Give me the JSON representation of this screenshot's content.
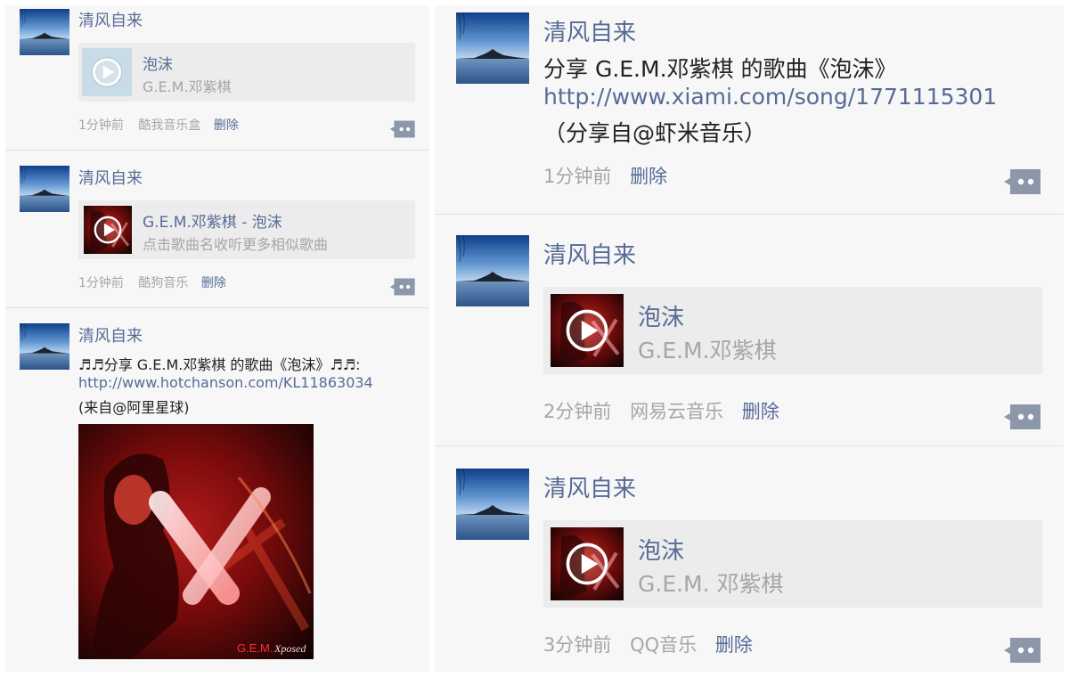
{
  "user_name": "清风自来",
  "delete_label": "删除",
  "left_feed": [
    {
      "card": {
        "title": "泡沫",
        "subtitle": "G.E.M.邓紫棋",
        "thumb": "gray-play"
      },
      "meta": {
        "time": "1分钟前",
        "source": "酷我音乐盒"
      }
    },
    {
      "card": {
        "title": "G.E.M.邓紫棋 - 泡沫",
        "subtitle": "点击歌曲名收听更多相似歌曲",
        "thumb": "album-art-play"
      },
      "meta": {
        "time": "1分钟前",
        "source": "酷狗音乐"
      }
    },
    {
      "text": "♬♬分享 G.E.M.邓紫棋 的歌曲《泡沫》♬♬:",
      "link": "http://www.hotchanson.com/KL11863034",
      "source_note": "(来自@阿里星球)",
      "image": {
        "brand": "G.E.M.",
        "album": "Xposed"
      }
    }
  ],
  "right_feed": [
    {
      "text": "分享  G.E.M.邓紫棋 的歌曲《泡沫》",
      "link": "http://www.xiami.com/song/1771115301",
      "source_note": "（分享自@虾米音乐）",
      "meta": {
        "time": "1分钟前",
        "source": ""
      }
    },
    {
      "card": {
        "title": "泡沫",
        "subtitle": "G.E.M.邓紫棋",
        "thumb": "album-art-play"
      },
      "meta": {
        "time": "2分钟前",
        "source": "网易云音乐"
      }
    },
    {
      "card": {
        "title": "泡沫",
        "subtitle": "G.E.M. 邓紫棋",
        "thumb": "album-art-play"
      },
      "meta": {
        "time": "3分钟前",
        "source": "QQ音乐"
      }
    }
  ],
  "icons": {
    "avatar": "lake-landscape-avatar",
    "comment": "comment-bubble-icon",
    "play": "play-icon"
  },
  "colors": {
    "link": "#576b95",
    "muted": "#a6a6a6",
    "card_bg": "#ececed",
    "panel_bg": "#f7f7f8",
    "comment_btn": "#8c97aa"
  }
}
